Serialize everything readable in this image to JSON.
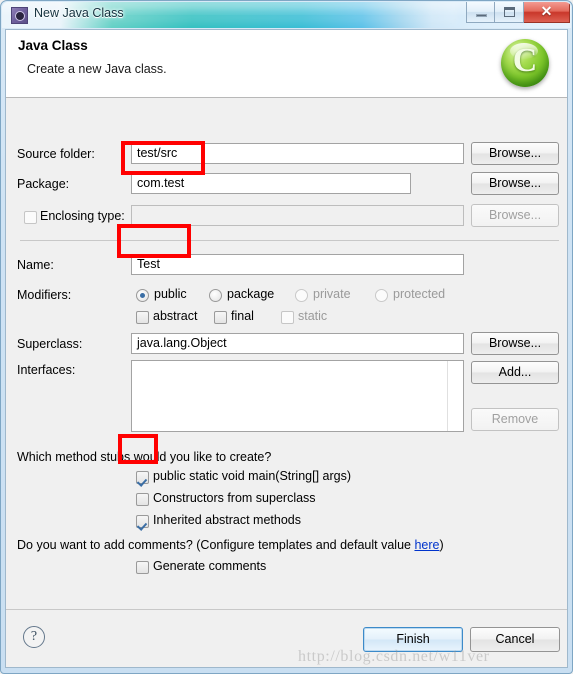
{
  "window": {
    "title": "New Java Class",
    "icon": "eclipse-wizard-icon",
    "controls": {
      "minimize": "minimize-icon",
      "maximize": "maximize-icon",
      "close": "✕"
    }
  },
  "header": {
    "title": "Java Class",
    "subtitle": "Create a new Java class.",
    "icon_letter": "C",
    "icon_name": "java-class-wizard-icon"
  },
  "form": {
    "source_folder": {
      "label": "Source folder:",
      "value": "test/src",
      "button": "Browse...",
      "enabled": true
    },
    "package": {
      "label": "Package:",
      "value": "com.test",
      "button": "Browse...",
      "enabled": true,
      "highlighted": true
    },
    "enclosing_type": {
      "label": "Enclosing type:",
      "value": "",
      "button": "Browse...",
      "checked": false,
      "enabled": false
    },
    "name": {
      "label": "Name:",
      "value": "Test",
      "highlighted": true
    },
    "modifiers": {
      "label": "Modifiers:",
      "radios": [
        {
          "label": "public",
          "selected": true,
          "enabled": true
        },
        {
          "label": "package",
          "selected": false,
          "enabled": true
        },
        {
          "label": "private",
          "selected": false,
          "enabled": false
        },
        {
          "label": "protected",
          "selected": false,
          "enabled": false
        }
      ],
      "checkboxes": [
        {
          "label": "abstract",
          "checked": false,
          "enabled": true
        },
        {
          "label": "final",
          "checked": false,
          "enabled": true
        },
        {
          "label": "static",
          "checked": false,
          "enabled": false
        }
      ]
    },
    "superclass": {
      "label": "Superclass:",
      "value": "java.lang.Object",
      "button": "Browse..."
    },
    "interfaces": {
      "label": "Interfaces:",
      "items": [],
      "add_button": "Add...",
      "remove_button": "Remove",
      "remove_enabled": false
    }
  },
  "stubs": {
    "question": "Which method stubs would you like to create?",
    "options": [
      {
        "label": "public static void main(String[] args)",
        "checked": true,
        "highlighted": true
      },
      {
        "label": "Constructors from superclass",
        "checked": false,
        "highlighted": false
      },
      {
        "label": "Inherited abstract methods",
        "checked": true,
        "highlighted": false
      }
    ]
  },
  "comments": {
    "question_prefix": "Do you want to add comments? (Configure templates and default value ",
    "link": "here",
    "question_suffix": ")",
    "checkbox": {
      "label": "Generate comments",
      "checked": false
    }
  },
  "footer": {
    "help_icon": "?",
    "finish_button": "Finish",
    "cancel_button": "Cancel"
  },
  "watermark": "http://blog.csdn.net/w11ver",
  "colors": {
    "annotation": "#ff0000",
    "accent_blue": "#3a6ea5",
    "link": "#0033cc",
    "title_gradient_teal": "#2fbfbf",
    "wizard_green": "#7ec72b"
  }
}
